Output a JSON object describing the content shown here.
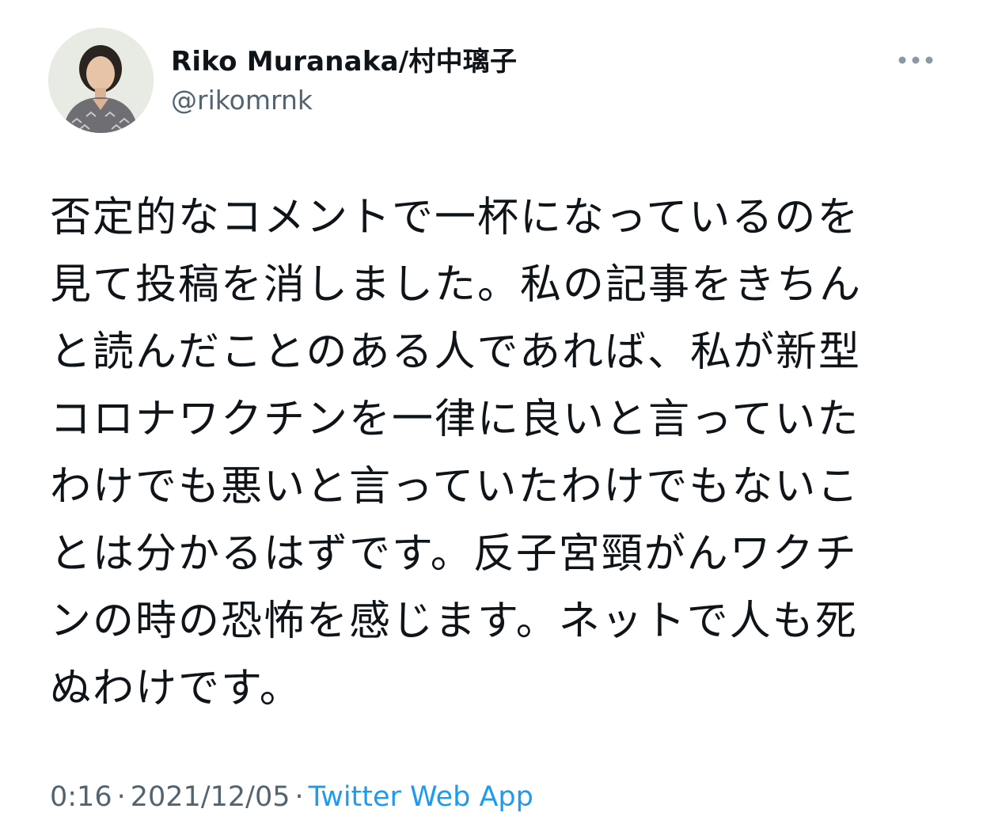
{
  "author": {
    "display_name": "Riko Muranaka/村中璃子",
    "handle": "@rikomrnk",
    "avatar_icon": "profile-photo"
  },
  "more_icon": "more-horizontal-icon",
  "tweet": {
    "lines": [
      "否定的なコメントで一杯になっているのを",
      "見て投稿を消しました。私の記事をきちん",
      "と読んだことのある人であれば、私が新型",
      "コロナワクチンを一律に良いと言っていた",
      "わけでも悪いと言っていたわけでもないこ",
      "とは分かるはずです。反子宮頸がんワクチ",
      "ンの時の恐怖を感じます。ネットで人も死",
      "ぬわけです。"
    ]
  },
  "meta": {
    "time": "0:16",
    "separator": "·",
    "date": "2021/12/05",
    "source": "Twitter Web App"
  },
  "colors": {
    "text": "#0f1419",
    "secondary": "#536471",
    "link": "#1d9bf0"
  }
}
